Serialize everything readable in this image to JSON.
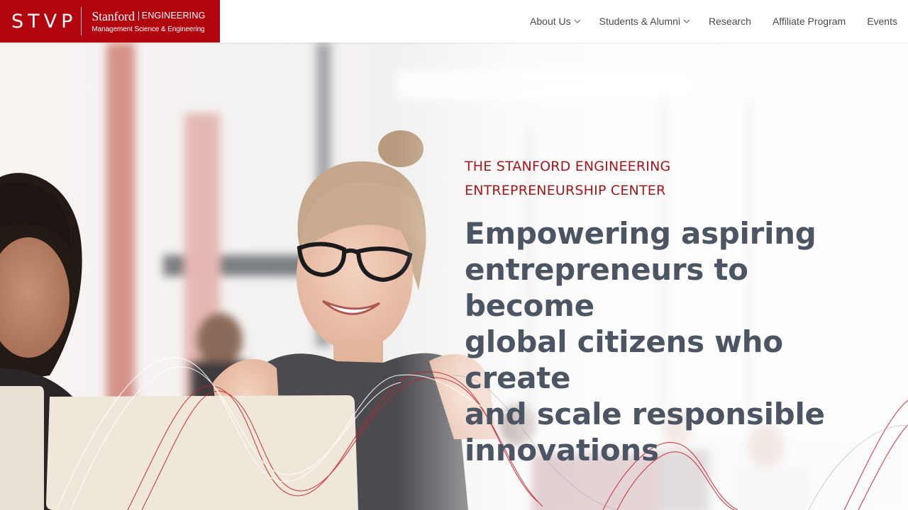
{
  "header": {
    "logo": {
      "stvp": "STVP",
      "stanford": "Stanford",
      "engineering": "ENGINEERING",
      "department": "Management Science & Engineering"
    },
    "nav": [
      {
        "label": "About Us",
        "dropdown": true
      },
      {
        "label": "Students & Alumni",
        "dropdown": true
      },
      {
        "label": "Research",
        "dropdown": false
      },
      {
        "label": "Affiliate Program",
        "dropdown": false
      },
      {
        "label": "Events",
        "dropdown": false
      }
    ]
  },
  "hero": {
    "eyebrow_line1": "THE STANFORD ENGINEERING",
    "eyebrow_line2": "ENTREPRENEURSHIP CENTER",
    "headline_lines": [
      "Empowering aspiring",
      "entrepreneurs to become",
      "global citizens who create",
      "and scale responsible",
      "innovations"
    ]
  },
  "colors": {
    "brand_red": "#b1040e",
    "eyebrow_red": "#a6161c",
    "headline_gray": "#4b5563",
    "nav_text": "#4a4a4a"
  },
  "icons": {
    "caret": "chevron-down-icon"
  }
}
